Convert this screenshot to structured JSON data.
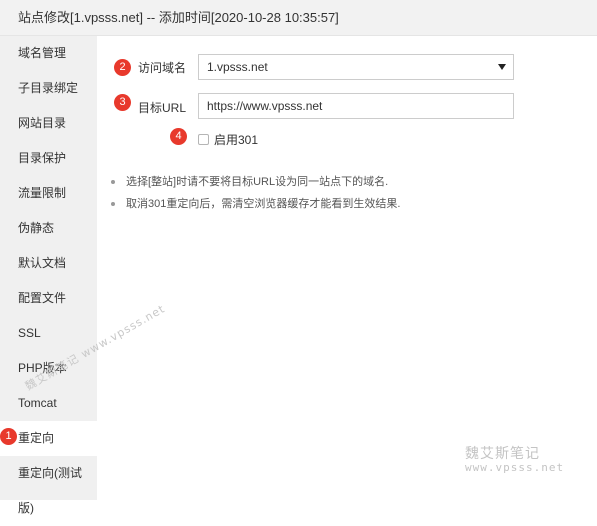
{
  "window": {
    "title": "站点修改[1.vpsss.net] -- 添加时间[2020-10-28 10:35:57]"
  },
  "sidebar": {
    "items": [
      {
        "label": "域名管理"
      },
      {
        "label": "子目录绑定"
      },
      {
        "label": "网站目录"
      },
      {
        "label": "目录保护"
      },
      {
        "label": "流量限制"
      },
      {
        "label": "伪静态"
      },
      {
        "label": "默认文档"
      },
      {
        "label": "配置文件"
      },
      {
        "label": "SSL"
      },
      {
        "label": "PHP版本"
      },
      {
        "label": "Tomcat"
      },
      {
        "label": "重定向"
      },
      {
        "label": "重定向(测试版)"
      }
    ],
    "active_index": 11
  },
  "badges": {
    "b1": "1",
    "b2": "2",
    "b3": "3",
    "b4": "4",
    "color": "#e8392c"
  },
  "form": {
    "domain_label": "访问域名",
    "domain_value": "1.vpsss.net",
    "url_label": "目标URL",
    "url_value": "https://www.vpsss.net",
    "checkbox_label": "启用301",
    "checkbox_checked": false
  },
  "tips": [
    "选择[整站]时请不要将目标URL设为同一站点下的域名.",
    "取消301重定向后，需清空浏览器缓存才能看到生效结果."
  ],
  "watermark": {
    "text_cn": "魏艾斯笔记",
    "text_url": "www.vpsss.net"
  },
  "icons": {
    "select": "chevron-down-icon",
    "bullet": "bullet-dot-icon"
  }
}
